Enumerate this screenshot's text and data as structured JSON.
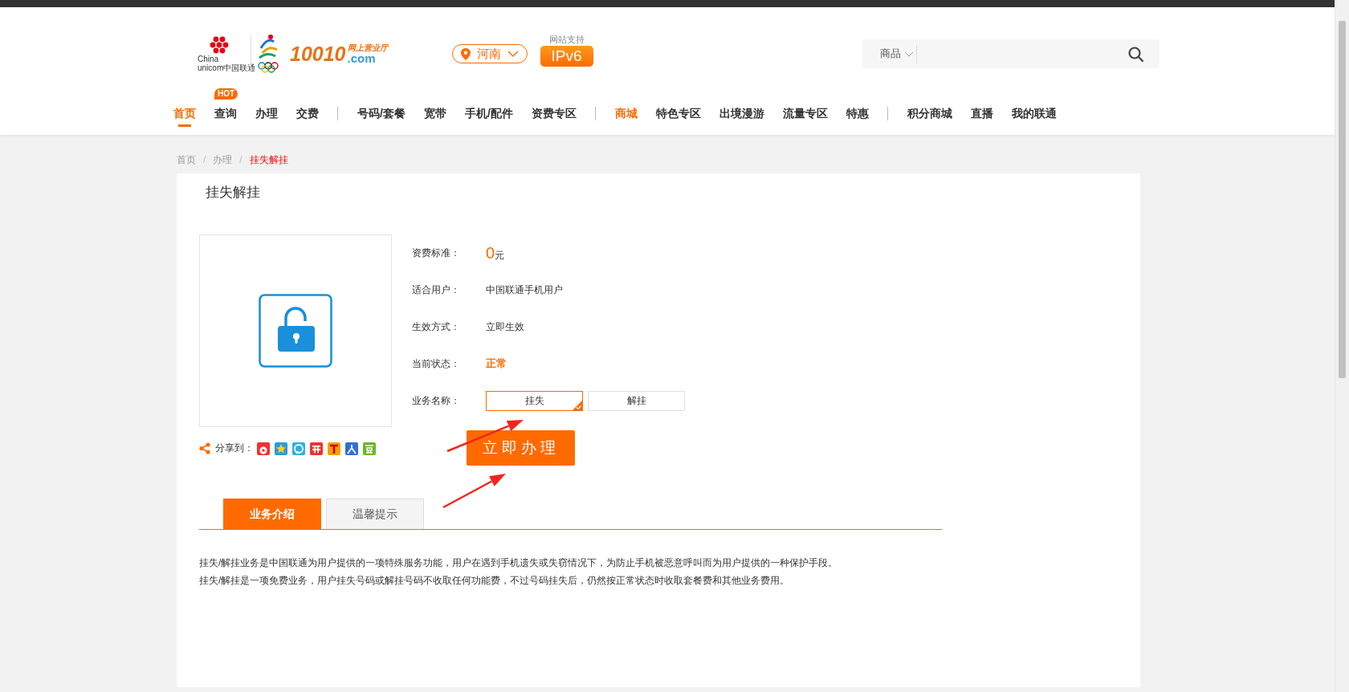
{
  "header": {
    "logo": {
      "brand_en_1": "China",
      "brand_en_2": "unicom中国联通",
      "number": "10010",
      "tagline": "网上营业厅",
      "domain": ".com"
    },
    "region": {
      "label": "河南"
    },
    "ipv6": {
      "caption": "网站支持",
      "label": "IPv6"
    },
    "search": {
      "category": "商品"
    },
    "hot_badge": "HOT",
    "nav": [
      {
        "label": "首页",
        "selected": true,
        "highlight": false,
        "divider_before": false
      },
      {
        "label": "查询",
        "selected": false,
        "highlight": false,
        "divider_before": false
      },
      {
        "label": "办理",
        "selected": false,
        "highlight": false,
        "divider_before": false
      },
      {
        "label": "交费",
        "selected": false,
        "highlight": false,
        "divider_before": false
      },
      {
        "label": "号码/套餐",
        "selected": false,
        "highlight": false,
        "divider_before": true
      },
      {
        "label": "宽带",
        "selected": false,
        "highlight": false,
        "divider_before": false
      },
      {
        "label": "手机/配件",
        "selected": false,
        "highlight": false,
        "divider_before": false
      },
      {
        "label": "资费专区",
        "selected": false,
        "highlight": false,
        "divider_before": false
      },
      {
        "label": "商城",
        "selected": false,
        "highlight": true,
        "divider_before": true
      },
      {
        "label": "特色专区",
        "selected": false,
        "highlight": false,
        "divider_before": false
      },
      {
        "label": "出境漫游",
        "selected": false,
        "highlight": false,
        "divider_before": false
      },
      {
        "label": "流量专区",
        "selected": false,
        "highlight": false,
        "divider_before": false
      },
      {
        "label": "特惠",
        "selected": false,
        "highlight": false,
        "divider_before": false
      },
      {
        "label": "积分商城",
        "selected": false,
        "highlight": false,
        "divider_before": true
      },
      {
        "label": "直播",
        "selected": false,
        "highlight": false,
        "divider_before": false
      },
      {
        "label": "我的联通",
        "selected": false,
        "highlight": false,
        "divider_before": false
      }
    ]
  },
  "breadcrumb": [
    {
      "label": "首页",
      "current": false
    },
    {
      "separator": "/",
      "label": "办理",
      "current": false
    },
    {
      "separator": "/",
      "label": "挂失解挂",
      "current": true
    }
  ],
  "page_title": "挂失解挂",
  "details": [
    {
      "label": "资费标准：",
      "kind": "price",
      "value": "0",
      "unit": "元"
    },
    {
      "label": "适合用户：",
      "kind": "text",
      "value": "中国联通手机用户"
    },
    {
      "label": "生效方式：",
      "kind": "text",
      "value": "立即生效"
    },
    {
      "label": "当前状态：",
      "kind": "status",
      "value": "正常"
    },
    {
      "label": "业务名称：",
      "kind": "options",
      "options": [
        {
          "label": "挂失",
          "selected": true
        },
        {
          "label": "解挂",
          "selected": false
        }
      ]
    }
  ],
  "share": {
    "label": "分享到："
  },
  "submit_button": "立即办理",
  "tabs": [
    {
      "label": "业务介绍",
      "selected": true
    },
    {
      "label": "温馨提示",
      "selected": false
    }
  ],
  "description": [
    "挂失/解挂业务是中国联通为用户提供的一项特殊服务功能，用户在遇到手机遗失或失窃情况下，为防止手机被恶意呼叫而为用户提供的一种保护手段。",
    "挂失/解挂是一项免费业务，用户挂失号码或解挂号码不收取任何功能费，不过号码挂失后，仍然按正常状态时收取套餐费和其他业务费用。"
  ]
}
